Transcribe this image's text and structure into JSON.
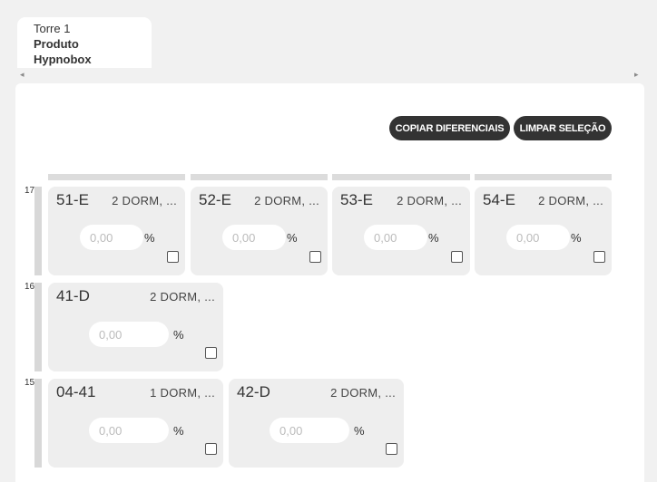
{
  "tab": {
    "tower": "Torre 1",
    "product_label": "Produto",
    "product_name": "Hypnobox"
  },
  "scroll": {
    "left_icon": "triangle-left-icon",
    "right_icon": "triangle-right-icon"
  },
  "actions": {
    "copy_label": "COPIAR DIFERENCIAIS",
    "clear_label": "LIMPAR SELEÇÃO"
  },
  "floors": [
    {
      "number": "17",
      "units": [
        {
          "number": "51-E",
          "type": "2 DORM, ...",
          "placeholder": "0,00",
          "suffix": "%"
        },
        {
          "number": "52-E",
          "type": "2 DORM, ...",
          "placeholder": "0,00",
          "suffix": "%"
        },
        {
          "number": "53-E",
          "type": "2 DORM, ...",
          "placeholder": "0,00",
          "suffix": "%"
        },
        {
          "number": "54-E",
          "type": "2 DORM, ...",
          "placeholder": "0,00",
          "suffix": "%"
        }
      ]
    },
    {
      "number": "16",
      "units": [
        {
          "number": "41-D",
          "type": "2 DORM, ...",
          "placeholder": "0,00",
          "suffix": "%"
        }
      ]
    },
    {
      "number": "15",
      "units": [
        {
          "number": "04-41",
          "type": "1 DORM, ...",
          "placeholder": "0,00",
          "suffix": "%"
        },
        {
          "number": "42-D",
          "type": "2 DORM, ...",
          "placeholder": "0,00",
          "suffix": "%"
        }
      ]
    }
  ]
}
